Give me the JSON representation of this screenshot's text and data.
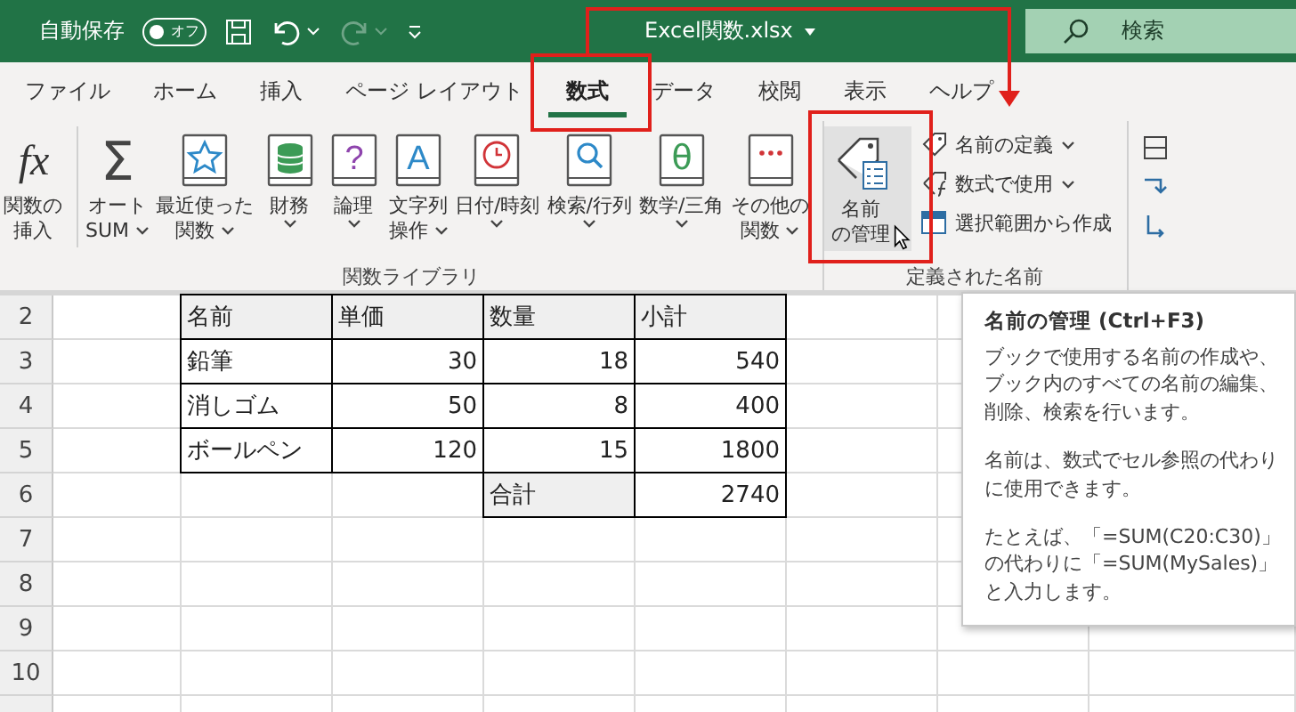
{
  "title_bar": {
    "autosave_label": "自動保存",
    "autosave": {
      "on": false,
      "label": "オフ"
    },
    "redo_disabled": true,
    "file_name": "Excel関数.xlsx",
    "search": {
      "placeholder": "検索"
    }
  },
  "tabs": [
    {
      "label": "ファイル",
      "selected": false,
      "highlighted": false
    },
    {
      "label": "ホーム",
      "selected": false,
      "highlighted": false
    },
    {
      "label": "挿入",
      "selected": false,
      "highlighted": false
    },
    {
      "label": "ページ レイアウト",
      "selected": false,
      "highlighted": false
    },
    {
      "label": "数式",
      "selected": true,
      "highlighted": true
    },
    {
      "label": "データ",
      "selected": false,
      "highlighted": false
    },
    {
      "label": "校閲",
      "selected": false,
      "highlighted": false
    },
    {
      "label": "表示",
      "selected": false,
      "highlighted": false
    },
    {
      "label": "ヘルプ",
      "selected": false,
      "highlighted": false
    }
  ],
  "ribbon": {
    "groups": [
      {
        "label": "関数ライブラリ",
        "buttons": [
          {
            "kind": "fx",
            "glyph": "fx",
            "lines": [
              "関数の",
              "挿入"
            ],
            "dropdown": false
          },
          {
            "kind": "sigma",
            "glyph": "Σ",
            "lines": [
              "オート",
              "SUM"
            ],
            "dropdown": true
          },
          {
            "kind": "star",
            "lines": [
              "最近使った",
              "関数"
            ],
            "dropdown": true
          },
          {
            "kind": "coins",
            "lines": [
              "財務"
            ],
            "dropdown": true
          },
          {
            "kind": "question",
            "glyph": "?",
            "lines": [
              "論理"
            ],
            "dropdown": true
          },
          {
            "kind": "letter",
            "glyph": "A",
            "lines": [
              "文字列",
              "操作"
            ],
            "dropdown": true
          },
          {
            "kind": "clock",
            "lines": [
              "日付/時刻"
            ],
            "dropdown": true
          },
          {
            "kind": "search",
            "lines": [
              "検索/行列"
            ],
            "dropdown": true
          },
          {
            "kind": "theta",
            "glyph": "θ",
            "lines": [
              "数学/三角"
            ],
            "dropdown": true
          },
          {
            "kind": "dots",
            "lines": [
              "その他の",
              "関数"
            ],
            "dropdown": true
          }
        ]
      },
      {
        "label": "定義された名前",
        "buttons": [
          {
            "kind": "tag",
            "lines": [
              "名前",
              "の管理"
            ],
            "dropdown": false,
            "hovered": true,
            "highlighted": true
          }
        ],
        "small_buttons": [
          {
            "kind": "tag",
            "label": "名前の定義",
            "dropdown": true
          },
          {
            "kind": "formula",
            "label": "数式で使用",
            "dropdown": true
          },
          {
            "kind": "selection",
            "label": "選択範囲から作成",
            "dropdown": false
          }
        ]
      }
    ]
  },
  "sheet": {
    "rows": [
      {
        "number": "2",
        "cells": [
          {
            "kind": "header",
            "text": "名前"
          },
          {
            "kind": "header",
            "text": "単価"
          },
          {
            "kind": "header",
            "text": "数量"
          },
          {
            "kind": "header",
            "text": "小計"
          }
        ]
      },
      {
        "number": "3",
        "cells": [
          {
            "kind": "text",
            "text": "鉛筆"
          },
          {
            "kind": "number",
            "text": "30"
          },
          {
            "kind": "number",
            "text": "18"
          },
          {
            "kind": "number",
            "text": "540"
          }
        ]
      },
      {
        "number": "4",
        "cells": [
          {
            "kind": "text",
            "text": "消しゴム"
          },
          {
            "kind": "number",
            "text": "50"
          },
          {
            "kind": "number",
            "text": "8"
          },
          {
            "kind": "number",
            "text": "400"
          }
        ]
      },
      {
        "number": "5",
        "cells": [
          {
            "kind": "text",
            "text": "ボールペン"
          },
          {
            "kind": "number",
            "text": "120"
          },
          {
            "kind": "number",
            "text": "15"
          },
          {
            "kind": "number",
            "text": "1800"
          }
        ]
      },
      {
        "number": "6",
        "cells": [
          {
            "kind": "empty"
          },
          {
            "kind": "empty"
          },
          {
            "kind": "header",
            "text": "合計"
          },
          {
            "kind": "number",
            "text": "2740"
          }
        ]
      },
      {
        "number": "7"
      },
      {
        "number": "8"
      },
      {
        "number": "9"
      },
      {
        "number": "10"
      }
    ]
  },
  "tooltip": {
    "title": "名前の管理 (Ctrl+F3)",
    "paragraphs": [
      "ブックで使用する名前の作成や、ブック内のすべての名前の編集、削除、検索を行います。",
      "名前は、数式でセル参照の代わりに使用できます。",
      "たとえば、「=SUM(C20:C30)」の代わりに「=SUM(MySales)」と入力します。"
    ]
  }
}
